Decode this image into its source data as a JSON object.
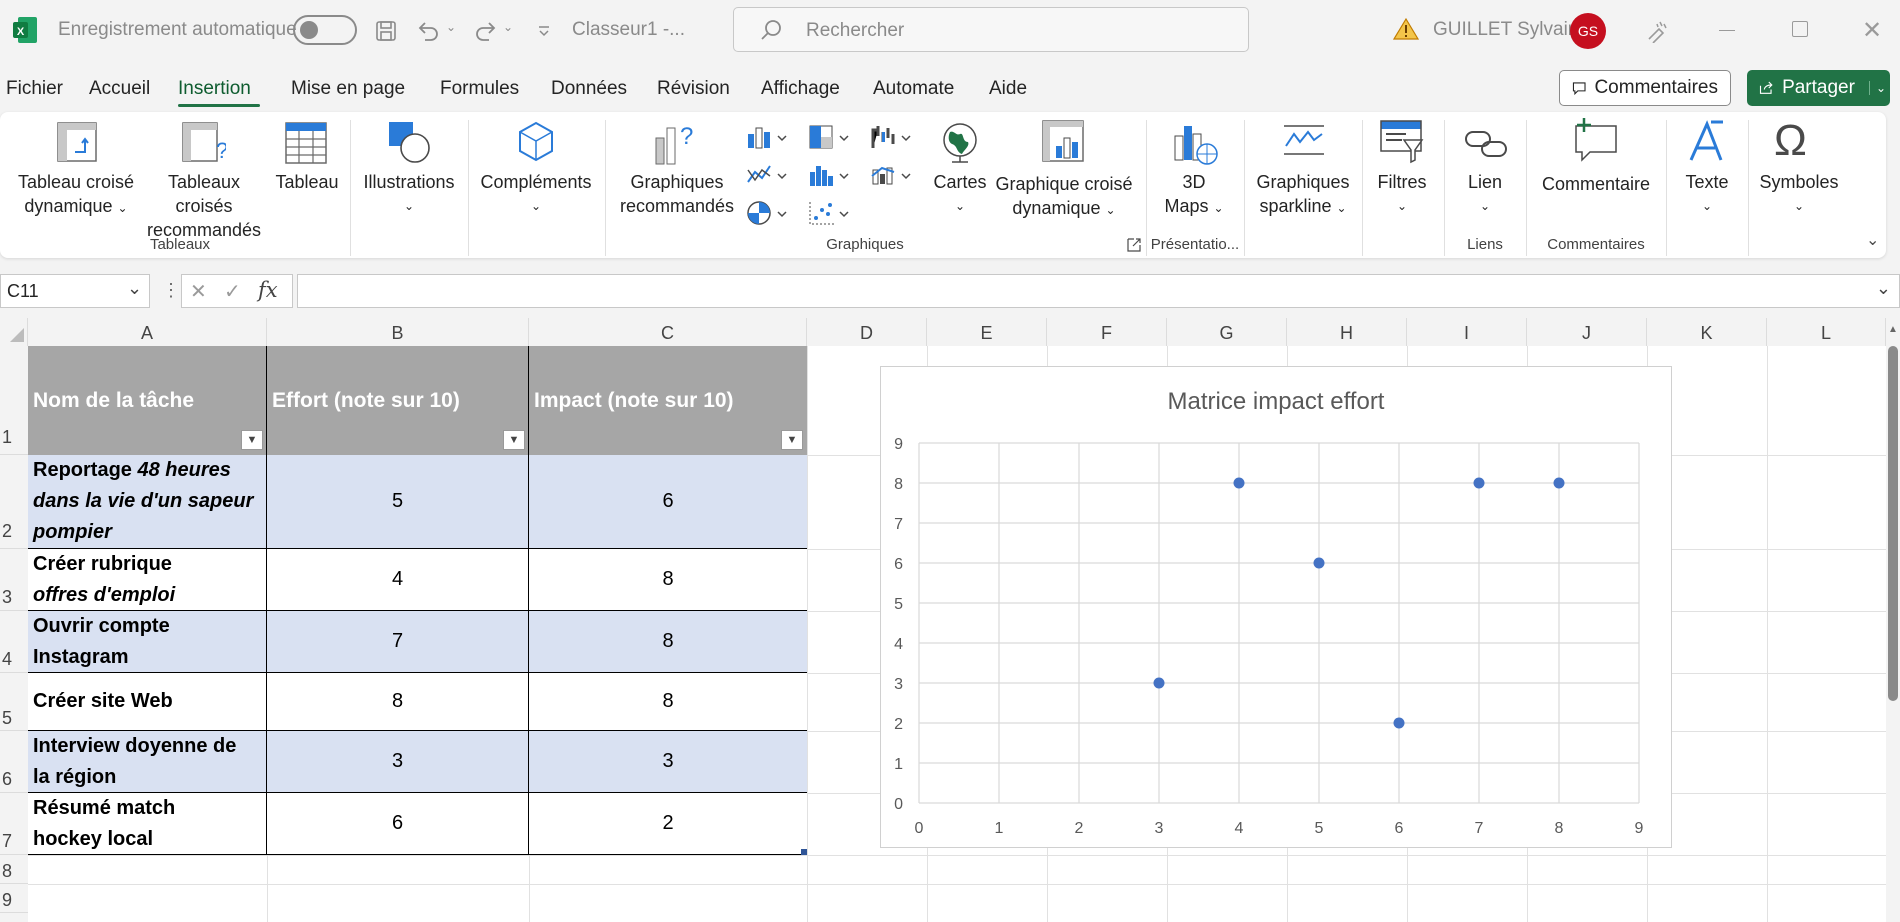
{
  "titlebar": {
    "autosave_label": "Enregistrement automatique",
    "filename": "Classeur1  -...",
    "search_placeholder": "Rechercher",
    "user_name": "GUILLET Sylvain",
    "user_initials": "GS"
  },
  "menu": {
    "items": [
      "Fichier",
      "Accueil",
      "Insertion",
      "Mise en page",
      "Formules",
      "Données",
      "Révision",
      "Affichage",
      "Automate",
      "Aide"
    ],
    "active": "Insertion",
    "comments_label": "Commentaires",
    "share_label": "Partager"
  },
  "ribbon": {
    "pivot_line1": "Tableau croisé",
    "pivot_line2": "dynamique",
    "rec_pivot_line1": "Tableaux croisés",
    "rec_pivot_line2": "recommandés",
    "table": "Tableau",
    "group_tables": "Tableaux",
    "illustrations": "Illustrations",
    "addins": "Compléments",
    "rec_charts_line1": "Graphiques",
    "rec_charts_line2": "recommandés",
    "maps": "Cartes",
    "pivot_chart_line1": "Graphique croisé",
    "pivot_chart_line2": "dynamique",
    "group_charts": "Graphiques",
    "maps3d_line1": "3D",
    "maps3d_line2": "Maps",
    "group_tours": "Présentatio...",
    "sparkline_line1": "Graphiques",
    "sparkline_line2": "sparkline",
    "filters": "Filtres",
    "link": "Lien",
    "group_links": "Liens",
    "comment": "Commentaire",
    "group_comments": "Commentaires",
    "text": "Texte",
    "symbols": "Symboles"
  },
  "formula_bar": {
    "name_box": "C11",
    "fx_label": "fx",
    "value": ""
  },
  "columns": [
    "A",
    "B",
    "C",
    "D",
    "E",
    "F",
    "G",
    "H",
    "I",
    "J",
    "K",
    "L"
  ],
  "rows": [
    "1",
    "2",
    "3",
    "4",
    "5",
    "6",
    "7",
    "8",
    "9"
  ],
  "table": {
    "headers": [
      "Nom de la tâche",
      "Effort (note sur 10)",
      "Impact (note sur 10)"
    ],
    "rows": [
      {
        "task_plain": "Reportage ",
        "task_italic": "48 heures dans la vie d'un sapeur pompier",
        "effort": "5",
        "impact": "6"
      },
      {
        "task_plain": "Créer rubrique ",
        "task_italic": "offres d'emploi",
        "effort": "4",
        "impact": "8"
      },
      {
        "task_plain": "Ouvrir compte Instagram",
        "task_italic": "",
        "effort": "7",
        "impact": "8"
      },
      {
        "task_plain": "Créer site Web",
        "task_italic": "",
        "effort": "8",
        "impact": "8"
      },
      {
        "task_plain": "Interview doyenne de la région",
        "task_italic": "",
        "effort": "3",
        "impact": "3"
      },
      {
        "task_plain": "Résumé match hockey local",
        "task_italic": "",
        "effort": "6",
        "impact": "2"
      }
    ]
  },
  "chart_data": {
    "type": "scatter",
    "title": "Matrice impact effort",
    "xlabel": "",
    "ylabel": "",
    "xlim": [
      0,
      9
    ],
    "ylim": [
      0,
      9
    ],
    "x_ticks": [
      "0",
      "1",
      "2",
      "3",
      "4",
      "5",
      "6",
      "7",
      "8",
      "9"
    ],
    "y_ticks": [
      "0",
      "1",
      "2",
      "3",
      "4",
      "5",
      "6",
      "7",
      "8",
      "9"
    ],
    "grid": true,
    "series": [
      {
        "x": [
          5,
          4,
          7,
          8,
          3,
          6
        ],
        "y": [
          6,
          8,
          8,
          8,
          3,
          2
        ]
      }
    ],
    "marker_color": "#4472c4"
  },
  "colors": {
    "accent": "#217346",
    "header_fill": "#a6a6a6",
    "band_fill": "#d9e1f2"
  }
}
